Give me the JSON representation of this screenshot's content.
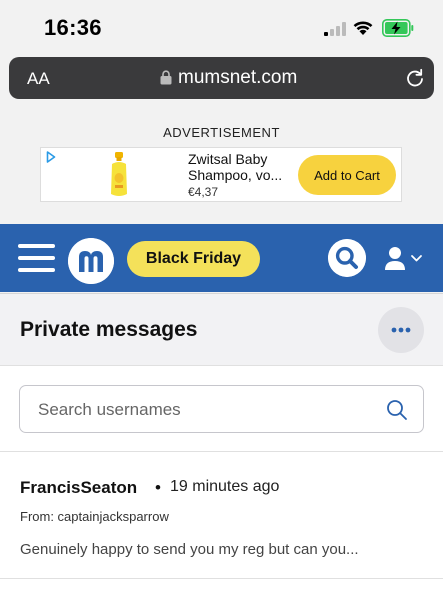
{
  "status_bar": {
    "time": "16:36"
  },
  "browser": {
    "text_size_label": "AA",
    "domain": "mumsnet.com"
  },
  "ad": {
    "label": "ADVERTISEMENT",
    "product_name": "Zwitsal Baby Shampoo, vo...",
    "price": "€4,37",
    "cta": "Add to Cart"
  },
  "nav": {
    "promo_label": "Black Friday"
  },
  "page": {
    "title": "Private messages",
    "search_placeholder": "Search usernames"
  },
  "messages": [
    {
      "sender": "FrancisSeaton",
      "separator": "•",
      "time": "19 minutes ago",
      "from": "From: captainjacksparrow",
      "preview": "Genuinely happy to send you my reg but can you..."
    }
  ],
  "colors": {
    "brand_blue": "#2a62ae",
    "promo_yellow": "#f4e15a",
    "cta_yellow": "#f7d23e",
    "battery_green": "#34c759"
  }
}
